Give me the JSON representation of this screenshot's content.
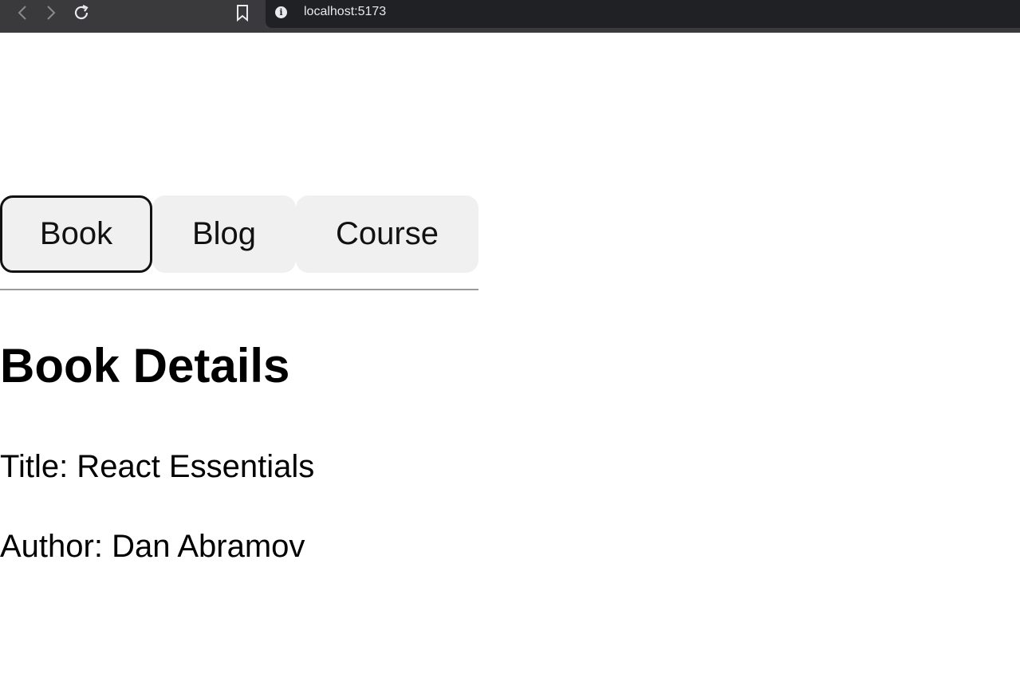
{
  "browser": {
    "url": "localhost:5173",
    "icons": [
      "back-icon",
      "forward-icon",
      "reload-icon",
      "bookmark-icon",
      "info-icon"
    ]
  },
  "tabs": [
    {
      "label": "Book",
      "active": true
    },
    {
      "label": "Blog",
      "active": false
    },
    {
      "label": "Course",
      "active": false
    }
  ],
  "content": {
    "heading": "Book Details",
    "title_line": "Title: React Essentials",
    "author_line": "Author: Dan Abramov"
  },
  "colors": {
    "tab_background": "#f0f0f0",
    "active_border": "#111111",
    "browser_bar": "#3c3c3f",
    "address_bar": "#202124"
  }
}
